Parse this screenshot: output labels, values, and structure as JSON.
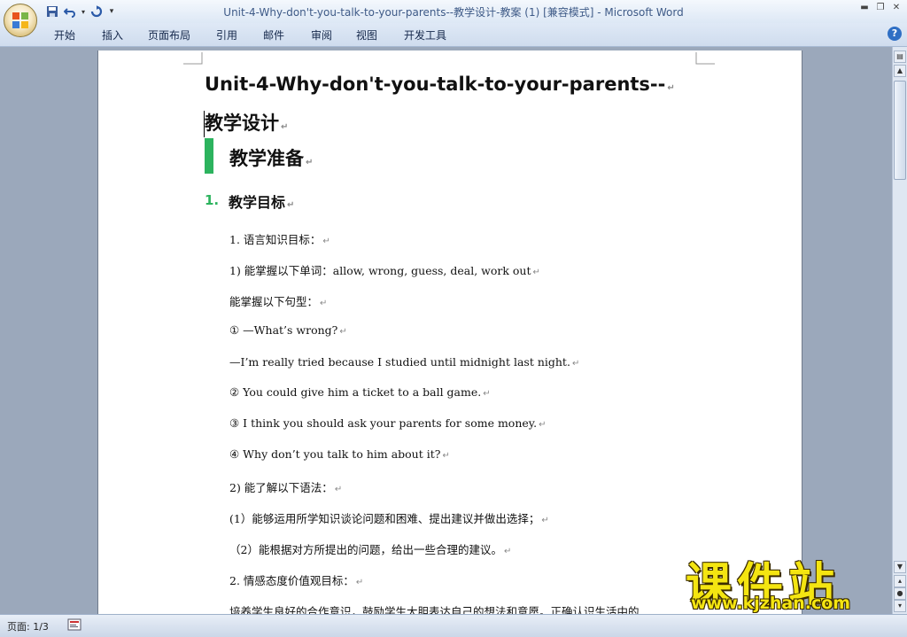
{
  "window": {
    "title": "Unit-4-Why-don't-you-talk-to-your-parents--教学设计-教案 (1) [兼容模式]",
    "title_separator": " - ",
    "app_name": "Microsoft Word"
  },
  "ribbon": {
    "tabs": [
      "开始",
      "插入",
      "页面布局",
      "引用",
      "邮件",
      "审阅",
      "视图",
      "开发工具"
    ]
  },
  "document": {
    "title_line1": "Unit-4-Why-don't-you-talk-to-your-parents--",
    "title_line2": "教学设计",
    "heading1": "教学准备",
    "heading2_number": "1.",
    "heading2": "教学目标",
    "paragraph_mark": "↵",
    "paragraphs": [
      "1. 语言知识目标：",
      "1) 能掌握以下单词：allow, wrong, guess, deal, work out",
      "能掌握以下句型：",
      "① —What’s wrong?",
      "—I’m really tried because I studied until midnight last night.",
      "② You could give him a ticket to a ball game.",
      "③ I think you should ask your parents for some money.",
      "④ Why don’t you talk to him about it?",
      "2) 能了解以下语法：",
      "(1）能够运用所学知识谈论问题和困难、提出建议并做出选择；",
      "（2）能根据对方所提出的问题，给出一些合理的建议。",
      "2. 情感态度价值观目标：",
      "培养学生良好的合作意识，鼓励学生大胆表达自己的想法和意愿。正确认识生活中的"
    ]
  },
  "statusbar": {
    "page": "页面: 1/3"
  },
  "watermark": {
    "main": "课件站",
    "url": "www.kjzhan.com"
  },
  "colors": {
    "accent_green": "#2cb35e",
    "title_blue": "#3e5a87",
    "watermark_yellow": "#f4e511"
  }
}
